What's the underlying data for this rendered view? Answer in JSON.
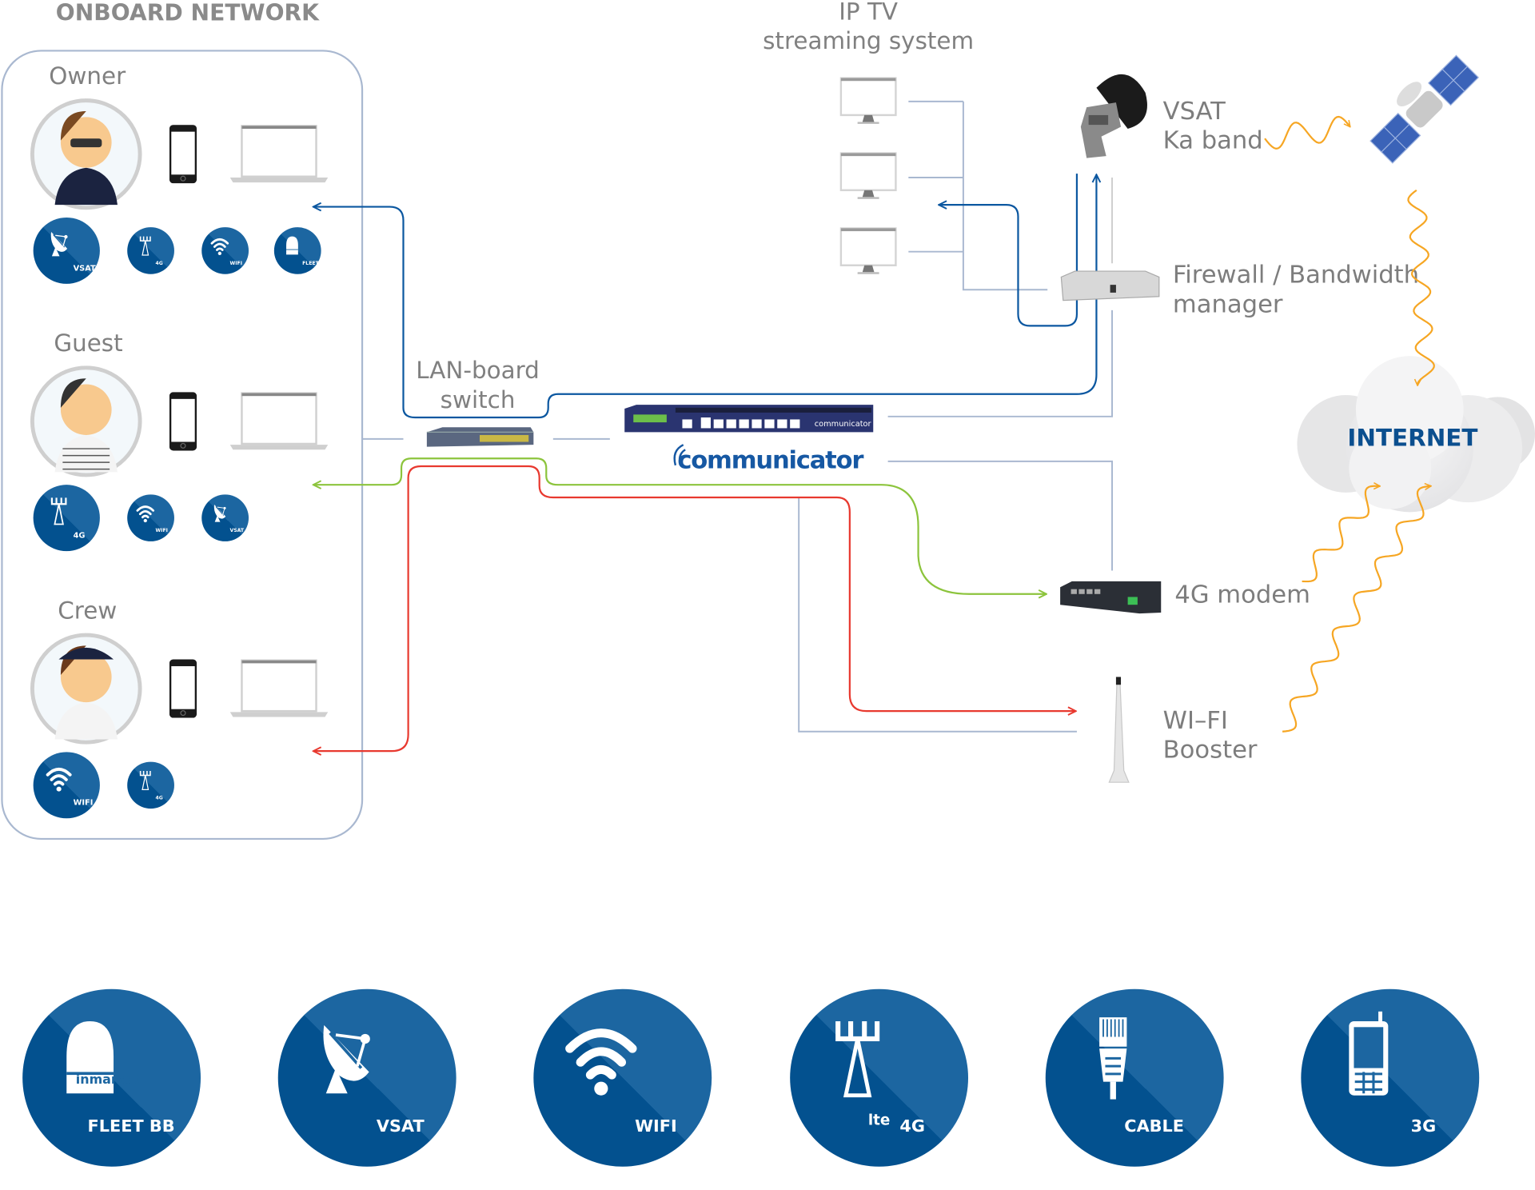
{
  "title": "ONBOARD NETWORK",
  "colors": {
    "icon_dark": "#03518f",
    "icon_light": "#1c66a1",
    "link_blue": "#0b57a0",
    "link_green": "#8cc43c",
    "link_red": "#e8392f",
    "wave_orange": "#f6a623",
    "panel_border": "#a9b8d0",
    "internet_text": "#0b4f8f"
  },
  "groups": [
    {
      "name": "Owner",
      "avatar": "owner-avatar",
      "icons": [
        {
          "type": "vsat",
          "label": "VSAT"
        },
        {
          "type": "4g",
          "label": "4G"
        },
        {
          "type": "wifi",
          "label": "WIFI"
        },
        {
          "type": "fleet",
          "label": "FLEET BB"
        }
      ]
    },
    {
      "name": "Guest",
      "avatar": "guest-avatar",
      "icons": [
        {
          "type": "4g",
          "label": "4G"
        },
        {
          "type": "wifi",
          "label": "WIFI"
        },
        {
          "type": "vsat",
          "label": "VSAT"
        }
      ]
    },
    {
      "name": "Crew",
      "avatar": "crew-avatar",
      "icons": [
        {
          "type": "wifi",
          "label": "WIFI"
        },
        {
          "type": "4g",
          "label": "4G"
        }
      ]
    }
  ],
  "labels": {
    "lan_switch": [
      "LAN-board",
      "switch"
    ],
    "iptv": [
      "IP TV",
      "streaming system"
    ],
    "vsat": [
      "VSAT",
      "Ka band"
    ],
    "firewall": [
      "Firewall / Bandwidth",
      "manager"
    ],
    "modem": "4G modem",
    "wifi_booster": [
      "WI–FI",
      "Booster"
    ],
    "internet": "INTERNET",
    "brand": "communicator",
    "device_brand": "communicator"
  },
  "legend": [
    {
      "type": "fleet",
      "label": "FLEET BB",
      "sub": "inmarsat"
    },
    {
      "type": "vsat",
      "label": "VSAT"
    },
    {
      "type": "wifi",
      "label": "WIFI"
    },
    {
      "type": "4g",
      "label": "4G",
      "sub": "lte"
    },
    {
      "type": "cable",
      "label": "CABLE"
    },
    {
      "type": "3g",
      "label": "3G"
    }
  ]
}
